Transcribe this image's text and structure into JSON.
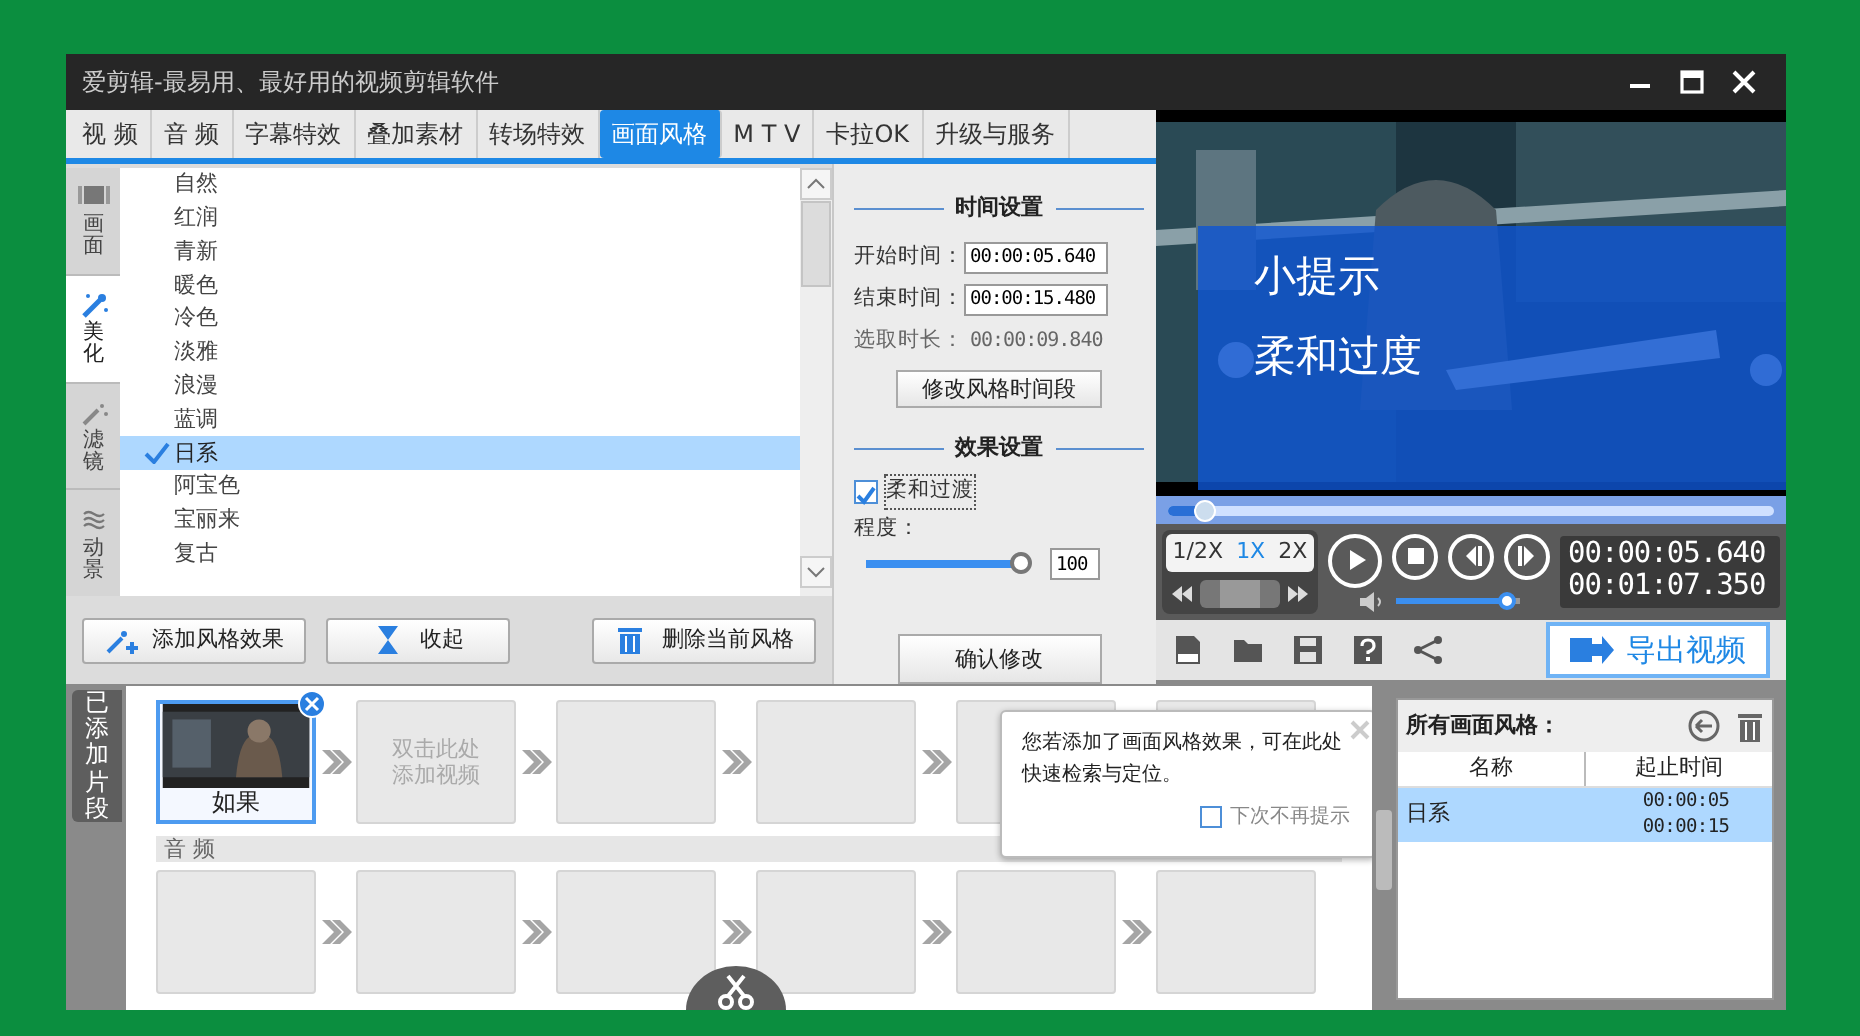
{
  "window": {
    "title": "爱剪辑-最易用、最好用的视频剪辑软件"
  },
  "tabs": [
    {
      "label": "视 频",
      "selected": false
    },
    {
      "label": "音 频",
      "selected": false
    },
    {
      "label": "字幕特效",
      "selected": false
    },
    {
      "label": "叠加素材",
      "selected": false
    },
    {
      "label": "转场特效",
      "selected": false
    },
    {
      "label": "画面风格",
      "selected": true
    },
    {
      "label": "M T V",
      "selected": false
    },
    {
      "label": "卡拉OK",
      "selected": false
    },
    {
      "label": "升级与服务",
      "selected": false
    }
  ],
  "side_tabs": [
    {
      "label": "画面",
      "kind": "frame",
      "selected": false
    },
    {
      "label": "美化",
      "kind": "wand",
      "selected": true
    },
    {
      "label": "滤镜",
      "kind": "sparkle",
      "selected": false
    },
    {
      "label": "动景",
      "kind": "wave",
      "selected": false
    }
  ],
  "style_list": [
    {
      "label": "自然",
      "selected": false
    },
    {
      "label": "红润",
      "selected": false
    },
    {
      "label": "青新",
      "selected": false
    },
    {
      "label": "暖色",
      "selected": false
    },
    {
      "label": "冷色",
      "selected": false
    },
    {
      "label": "淡雅",
      "selected": false
    },
    {
      "label": "浪漫",
      "selected": false
    },
    {
      "label": "蓝调",
      "selected": false
    },
    {
      "label": "日系",
      "selected": true
    },
    {
      "label": "阿宝色",
      "selected": false
    },
    {
      "label": "宝丽来",
      "selected": false
    },
    {
      "label": "复古",
      "selected": false
    }
  ],
  "list_buttons": [
    {
      "label": "添加风格效果",
      "kind": "add"
    },
    {
      "label": "收起",
      "kind": "collapse"
    },
    {
      "label": "删除当前风格",
      "kind": "delete"
    }
  ],
  "time_settings": {
    "heading": "时间设置",
    "fields": [
      {
        "label": "开始时间：",
        "value": "00:00:05.640"
      },
      {
        "label": "结束时间：",
        "value": "00:00:15.480"
      }
    ],
    "duration_label": "选取时长：",
    "duration": "00:00:09.840",
    "button": "修改风格时间段"
  },
  "effect_settings": {
    "heading": "效果设置",
    "checkbox": {
      "label": "柔和过渡",
      "checked": true
    },
    "degree_label": "程度：",
    "slider": {
      "level": 1.0
    },
    "value": "100",
    "confirm": "确认修改"
  },
  "preview": {
    "tip_title": "小提示",
    "tip_text": "柔和过度",
    "progress": {
      "level": 0.06
    },
    "speeds": [
      {
        "label": "1/2X",
        "selected": false
      },
      {
        "label": "1X",
        "selected": true
      },
      {
        "label": "2X",
        "selected": false
      }
    ],
    "current_time": "00:00:05.640",
    "total_time": "00:01:07.350",
    "volume": {
      "level": 0.9
    },
    "export": "导出视频"
  },
  "clips_tab": "已添加片段",
  "clips": [
    {
      "kind": "video",
      "label": "如果"
    },
    {
      "kind": "placeholder",
      "lines": [
        "双击此处",
        "添加视频"
      ],
      "arrow": true
    },
    {
      "kind": "empty",
      "arrow": true
    },
    {
      "kind": "empty",
      "arrow": true
    },
    {
      "kind": "empty",
      "arrow": true
    },
    {
      "kind": "empty",
      "arrow": false
    }
  ],
  "audio_label": "音 频",
  "audio_slots": [
    {
      "kind": "empty"
    },
    {
      "kind": "empty"
    },
    {
      "kind": "empty"
    },
    {
      "kind": "empty"
    },
    {
      "kind": "empty"
    },
    {
      "kind": "empty"
    }
  ],
  "tooltip": {
    "text": "您若添加了画面风格效果，可在此处快速检索与定位。",
    "checkbox": {
      "label": "下次不再提示",
      "checked": false
    }
  },
  "styles_panel": {
    "title": "所有画面风格：",
    "columns": [
      "名称",
      "起止时间"
    ],
    "rows": [
      {
        "name": "日系",
        "start": "00:00:05",
        "end": "00:00:15",
        "selected": true
      }
    ]
  }
}
